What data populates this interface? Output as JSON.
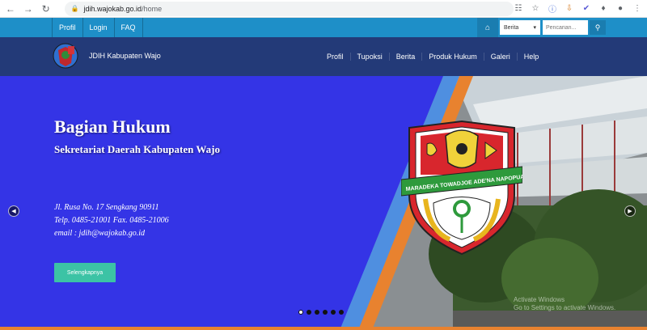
{
  "browser": {
    "url_host": "jdih.wajokab.go.id",
    "url_path": "/home"
  },
  "topbar": {
    "links": [
      "Profil",
      "Login",
      "FAQ"
    ],
    "select_value": "Berita",
    "search_placeholder": "Pencarian..."
  },
  "header": {
    "site_title": "JDIH Kabupaten Wajo",
    "nav": [
      "Profil",
      "Tupoksi",
      "Berita",
      "Produk Hukum",
      "Galeri",
      "Help"
    ]
  },
  "hero": {
    "title": "Bagian Hukum",
    "subtitle": "Sekretariat Daerah Kabupaten Wajo",
    "address_lines": [
      "Jl. Rusa No. 17 Sengkang 90911",
      "Telp. 0485-21001 Fax. 0485-21006",
      "email : jdih@wajokab.go.id"
    ],
    "button_label": "Selengkapnya",
    "emblem_banner": "MARADEKA TOWADJOE ADE'NA NAPOPUANG",
    "slides_total": 6,
    "active_slide": 1
  },
  "watermark": {
    "line1": "Activate Windows",
    "line2": "Go to Settings to activate Windows."
  },
  "colors": {
    "topbar": "#1e8fc8",
    "header": "#233a78",
    "hero_blue": "#3434e6",
    "accent_orange": "#e8822f",
    "button_teal": "#3cc3a5"
  }
}
